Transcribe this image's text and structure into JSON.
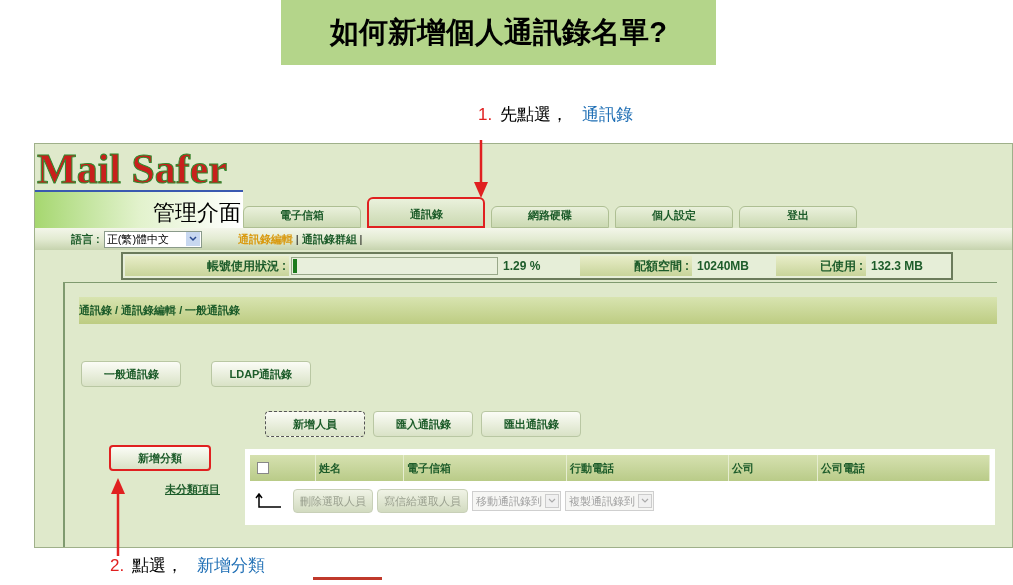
{
  "title": "如何新增個人通訊錄名單?",
  "step1": {
    "number": "1.",
    "text": "先點選，",
    "target": "通訊錄"
  },
  "app": {
    "logo": "Mail Safer",
    "logo_subtitle": "管理介面",
    "tabs": [
      {
        "label": "電子信箱",
        "selected": false,
        "highlighted": false
      },
      {
        "label": "通訊錄",
        "selected": true,
        "highlighted": true
      },
      {
        "label": "網路硬碟",
        "selected": false,
        "highlighted": false
      },
      {
        "label": "個人設定",
        "selected": false,
        "highlighted": false
      },
      {
        "label": "登出",
        "selected": false,
        "highlighted": false
      }
    ],
    "language": {
      "label": "語言 :",
      "value": "正(繁)體中文"
    },
    "subnav": [
      {
        "kind": "link",
        "label": "通訊錄編輯",
        "selected": true
      },
      {
        "kind": "separator",
        "label": "|"
      },
      {
        "kind": "link",
        "label": "通訊錄群組",
        "selected": false
      },
      {
        "kind": "separator",
        "label": "|"
      }
    ],
    "usage": {
      "label": "帳號使用狀況 :",
      "level": 0.0129,
      "percent": "1.29 %",
      "quota_label": "配額空間 :",
      "quota": "10240MB",
      "used_label": "已使用 :",
      "used": "132.3 MB"
    },
    "breadcrumb": "通訊錄 / 通訊錄編輯 / 一般通訊錄",
    "book_buttons": [
      "一般通訊錄",
      "LDAP通訊錄"
    ],
    "actions": [
      {
        "label": "新增人員",
        "focused": true
      },
      {
        "label": "匯入通訊錄",
        "focused": false
      },
      {
        "label": "匯出通訊錄",
        "focused": false
      }
    ],
    "add_category": {
      "label": "新增分類",
      "highlighted": true
    },
    "uncategorized": "未分類項目",
    "table": {
      "select_all": {
        "checked": false
      },
      "columns": [
        "姓名",
        "電子信箱",
        "行動電話",
        "公司",
        "公司電話"
      ]
    },
    "footer": {
      "buttons": [
        {
          "label": "刪除選取人員",
          "disabled": true
        },
        {
          "label": "寫信給選取人員",
          "disabled": true
        }
      ],
      "selects": [
        {
          "value": "移動通訊錄到",
          "disabled": true
        },
        {
          "value": "複製通訊錄到",
          "disabled": true
        }
      ]
    }
  },
  "step2": {
    "number": "2.",
    "text": "點選，",
    "target": "新增分類"
  }
}
